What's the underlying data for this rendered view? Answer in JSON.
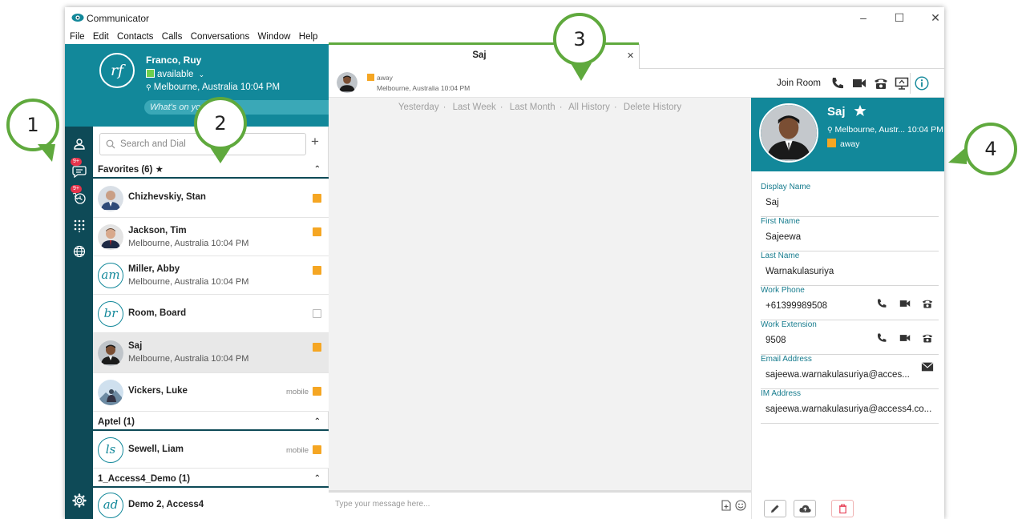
{
  "window": {
    "title": "Communicator"
  },
  "menu": [
    "File",
    "Edit",
    "Contacts",
    "Calls",
    "Conversations",
    "Window",
    "Help"
  ],
  "profile": {
    "initials": "rf",
    "name": "Franco, Ruy",
    "status": "available",
    "location": "Melbourne, Australia  10:04 PM",
    "mood_placeholder": "What's on your mind?"
  },
  "rail": {
    "badge1": "9+",
    "badge2": "9+"
  },
  "search": {
    "placeholder": "Search and Dial"
  },
  "groups": [
    {
      "label": "Favorites (6) ★"
    },
    {
      "label": "Aptel (1)"
    },
    {
      "label": "1_Access4_Demo (1)"
    }
  ],
  "contacts": [
    {
      "name": "Chizhevskiy, Stan",
      "location": ""
    },
    {
      "name": "Jackson, Tim",
      "location": "Melbourne, Australia 10:04 PM"
    },
    {
      "name": "Miller, Abby",
      "location": "Melbourne, Australia 10:04 PM",
      "initials": "am"
    },
    {
      "name": "Room, Board",
      "location": "",
      "initials": "br"
    },
    {
      "name": "Saj",
      "location": "Melbourne, Australia 10:04 PM"
    },
    {
      "name": "Vickers, Luke",
      "location": "",
      "tag": "mobile"
    },
    {
      "name": "Sewell, Liam",
      "location": "",
      "tag": "mobile",
      "initials": "ls"
    },
    {
      "name": "Demo 2, Access4",
      "location": "",
      "initials": "ad"
    }
  ],
  "chat": {
    "tab_title": "Saj",
    "status": "away",
    "location": "Melbourne, Australia 10:04 PM",
    "join_room": "Join Room",
    "history": [
      "Yesterday",
      "Last Week",
      "Last Month",
      "All History",
      "Delete History"
    ],
    "compose_placeholder": "Type your message here..."
  },
  "info": {
    "name": "Saj",
    "location": "Melbourne, Austr...  10:04 PM",
    "status": "away",
    "fields": [
      {
        "label": "Display Name",
        "value": "Saj"
      },
      {
        "label": "First Name",
        "value": "Sajeewa"
      },
      {
        "label": "Last Name",
        "value": "Warnakulasuriya"
      },
      {
        "label": "Work Phone",
        "value": "+61399989508"
      },
      {
        "label": "Work Extension",
        "value": "9508"
      },
      {
        "label": "Email Address",
        "value": "sajeewa.warnakulasuriya@acces..."
      },
      {
        "label": "IM Address",
        "value": "sajeewa.warnakulasuriya@access4.co..."
      }
    ]
  },
  "callouts": [
    "1",
    "2",
    "3",
    "4"
  ],
  "colors": {
    "teal": "#12889a",
    "dark_teal": "#0e4a57",
    "away": "#f5a623",
    "callout_green": "#5fa93d"
  }
}
